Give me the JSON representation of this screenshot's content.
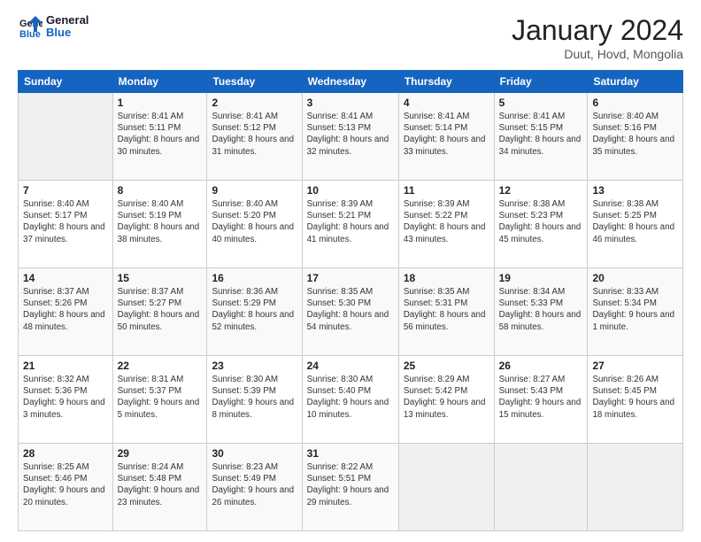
{
  "logo": {
    "line1": "General",
    "line2": "Blue"
  },
  "title": "January 2024",
  "location": "Duut, Hovd, Mongolia",
  "days_header": [
    "Sunday",
    "Monday",
    "Tuesday",
    "Wednesday",
    "Thursday",
    "Friday",
    "Saturday"
  ],
  "weeks": [
    [
      {
        "num": "",
        "detail": ""
      },
      {
        "num": "1",
        "detail": "Sunrise: 8:41 AM\nSunset: 5:11 PM\nDaylight: 8 hours\nand 30 minutes."
      },
      {
        "num": "2",
        "detail": "Sunrise: 8:41 AM\nSunset: 5:12 PM\nDaylight: 8 hours\nand 31 minutes."
      },
      {
        "num": "3",
        "detail": "Sunrise: 8:41 AM\nSunset: 5:13 PM\nDaylight: 8 hours\nand 32 minutes."
      },
      {
        "num": "4",
        "detail": "Sunrise: 8:41 AM\nSunset: 5:14 PM\nDaylight: 8 hours\nand 33 minutes."
      },
      {
        "num": "5",
        "detail": "Sunrise: 8:41 AM\nSunset: 5:15 PM\nDaylight: 8 hours\nand 34 minutes."
      },
      {
        "num": "6",
        "detail": "Sunrise: 8:40 AM\nSunset: 5:16 PM\nDaylight: 8 hours\nand 35 minutes."
      }
    ],
    [
      {
        "num": "7",
        "detail": "Sunrise: 8:40 AM\nSunset: 5:17 PM\nDaylight: 8 hours\nand 37 minutes."
      },
      {
        "num": "8",
        "detail": "Sunrise: 8:40 AM\nSunset: 5:19 PM\nDaylight: 8 hours\nand 38 minutes."
      },
      {
        "num": "9",
        "detail": "Sunrise: 8:40 AM\nSunset: 5:20 PM\nDaylight: 8 hours\nand 40 minutes."
      },
      {
        "num": "10",
        "detail": "Sunrise: 8:39 AM\nSunset: 5:21 PM\nDaylight: 8 hours\nand 41 minutes."
      },
      {
        "num": "11",
        "detail": "Sunrise: 8:39 AM\nSunset: 5:22 PM\nDaylight: 8 hours\nand 43 minutes."
      },
      {
        "num": "12",
        "detail": "Sunrise: 8:38 AM\nSunset: 5:23 PM\nDaylight: 8 hours\nand 45 minutes."
      },
      {
        "num": "13",
        "detail": "Sunrise: 8:38 AM\nSunset: 5:25 PM\nDaylight: 8 hours\nand 46 minutes."
      }
    ],
    [
      {
        "num": "14",
        "detail": "Sunrise: 8:37 AM\nSunset: 5:26 PM\nDaylight: 8 hours\nand 48 minutes."
      },
      {
        "num": "15",
        "detail": "Sunrise: 8:37 AM\nSunset: 5:27 PM\nDaylight: 8 hours\nand 50 minutes."
      },
      {
        "num": "16",
        "detail": "Sunrise: 8:36 AM\nSunset: 5:29 PM\nDaylight: 8 hours\nand 52 minutes."
      },
      {
        "num": "17",
        "detail": "Sunrise: 8:35 AM\nSunset: 5:30 PM\nDaylight: 8 hours\nand 54 minutes."
      },
      {
        "num": "18",
        "detail": "Sunrise: 8:35 AM\nSunset: 5:31 PM\nDaylight: 8 hours\nand 56 minutes."
      },
      {
        "num": "19",
        "detail": "Sunrise: 8:34 AM\nSunset: 5:33 PM\nDaylight: 8 hours\nand 58 minutes."
      },
      {
        "num": "20",
        "detail": "Sunrise: 8:33 AM\nSunset: 5:34 PM\nDaylight: 9 hours\nand 1 minute."
      }
    ],
    [
      {
        "num": "21",
        "detail": "Sunrise: 8:32 AM\nSunset: 5:36 PM\nDaylight: 9 hours\nand 3 minutes."
      },
      {
        "num": "22",
        "detail": "Sunrise: 8:31 AM\nSunset: 5:37 PM\nDaylight: 9 hours\nand 5 minutes."
      },
      {
        "num": "23",
        "detail": "Sunrise: 8:30 AM\nSunset: 5:39 PM\nDaylight: 9 hours\nand 8 minutes."
      },
      {
        "num": "24",
        "detail": "Sunrise: 8:30 AM\nSunset: 5:40 PM\nDaylight: 9 hours\nand 10 minutes."
      },
      {
        "num": "25",
        "detail": "Sunrise: 8:29 AM\nSunset: 5:42 PM\nDaylight: 9 hours\nand 13 minutes."
      },
      {
        "num": "26",
        "detail": "Sunrise: 8:27 AM\nSunset: 5:43 PM\nDaylight: 9 hours\nand 15 minutes."
      },
      {
        "num": "27",
        "detail": "Sunrise: 8:26 AM\nSunset: 5:45 PM\nDaylight: 9 hours\nand 18 minutes."
      }
    ],
    [
      {
        "num": "28",
        "detail": "Sunrise: 8:25 AM\nSunset: 5:46 PM\nDaylight: 9 hours\nand 20 minutes."
      },
      {
        "num": "29",
        "detail": "Sunrise: 8:24 AM\nSunset: 5:48 PM\nDaylight: 9 hours\nand 23 minutes."
      },
      {
        "num": "30",
        "detail": "Sunrise: 8:23 AM\nSunset: 5:49 PM\nDaylight: 9 hours\nand 26 minutes."
      },
      {
        "num": "31",
        "detail": "Sunrise: 8:22 AM\nSunset: 5:51 PM\nDaylight: 9 hours\nand 29 minutes."
      },
      {
        "num": "",
        "detail": ""
      },
      {
        "num": "",
        "detail": ""
      },
      {
        "num": "",
        "detail": ""
      }
    ]
  ]
}
